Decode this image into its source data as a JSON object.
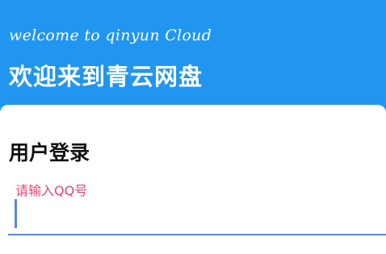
{
  "header": {
    "subtitle": "welcome to qinyun Cloud",
    "title": "欢迎来到青云网盘"
  },
  "login": {
    "heading": "用户登录",
    "qq_field": {
      "label": "请输入QQ号",
      "value": ""
    }
  },
  "colors": {
    "header_background": "#2196f0",
    "label_pink": "#e0457a",
    "focus_blue": "#5c86e6"
  }
}
